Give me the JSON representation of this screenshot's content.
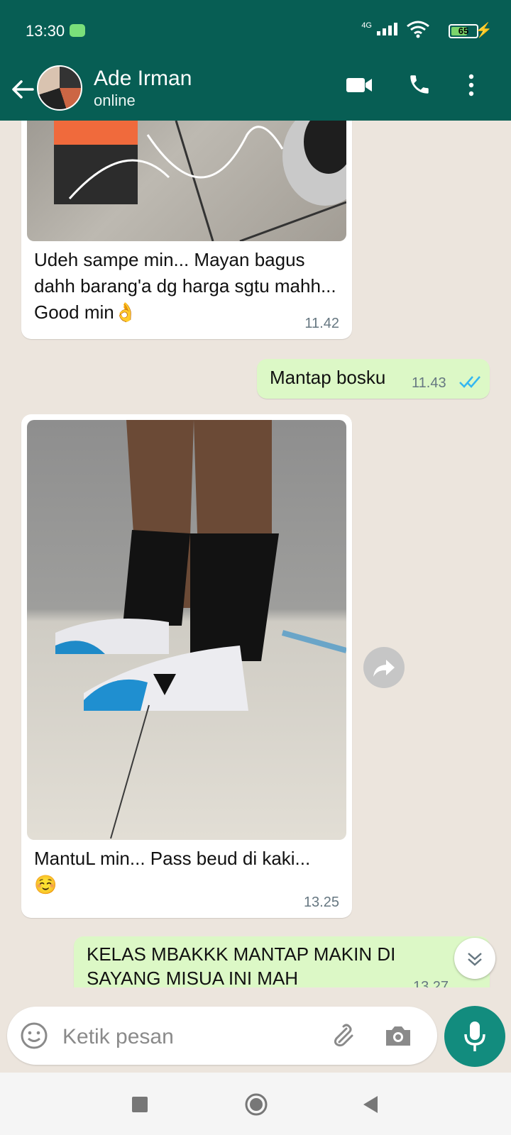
{
  "status_bar": {
    "time": "13:30",
    "network": "4G",
    "battery": "65",
    "battery_level": 0.65
  },
  "header": {
    "contact_name": "Ade Irman",
    "presence": "online",
    "icons": [
      "back-arrow-icon",
      "video-call-icon",
      "phone-icon",
      "more-vert-icon"
    ]
  },
  "messages": [
    {
      "direction": "incoming",
      "has_image": true,
      "image_desc": "",
      "text": "Udeh sampe min... Mayan bagus dahh barang'a dg harga sgtu mahh... Good min👌",
      "time": "11.42"
    },
    {
      "direction": "outgoing",
      "text": "Mantap bosku",
      "time": "11.43",
      "status": "read"
    },
    {
      "direction": "incoming",
      "has_image": true,
      "text": "MantuL min... Pass beud di kaki...☺️",
      "time": "13.25"
    },
    {
      "direction": "outgoing",
      "text": "KELAS MBAKKK MANTAP MAKIN DI SAYANG MISUA INI MAH",
      "time": "13.27"
    }
  ],
  "composer": {
    "placeholder": "Ketik pesan",
    "icons": [
      "emoji-icon",
      "attach-icon",
      "camera-icon",
      "mic-icon"
    ]
  },
  "colors": {
    "header": "#075e54",
    "incoming_bubble": "#ffffff",
    "outgoing_bubble": "#dcf8c6",
    "read_tick": "#34b7f1",
    "fab": "#128c7e"
  }
}
